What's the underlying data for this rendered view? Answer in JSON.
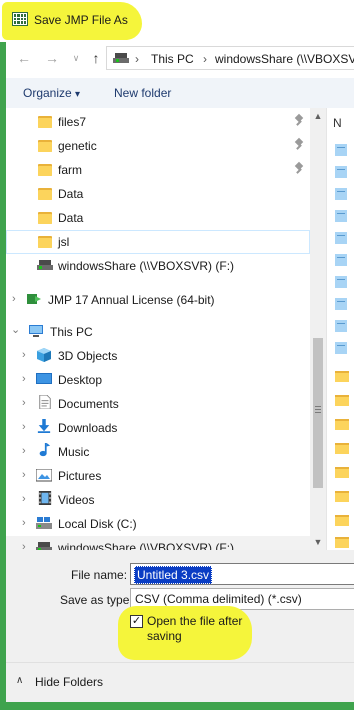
{
  "window": {
    "title": "Save JMP File As",
    "highlight_color": "#f5f53b",
    "frame_color": "#3fa34d"
  },
  "address": {
    "back_icon": "←",
    "forward_icon": "→",
    "dropdown_icon": "∨",
    "up_icon": "↑",
    "chevron": "›",
    "crumbs": [
      "This PC",
      "windowsShare (\\\\VBOXSVR"
    ]
  },
  "toolbar": {
    "organize_label": "Organize",
    "organize_arrow": "▾",
    "new_folder_label": "New folder"
  },
  "nav_pane": {
    "quick_items": [
      {
        "label": "files7",
        "pinned": true
      },
      {
        "label": "genetic",
        "pinned": true
      },
      {
        "label": "farm",
        "pinned": true
      },
      {
        "label": "Data",
        "pinned": false
      },
      {
        "label": "Data",
        "pinned": false
      },
      {
        "label": "jsl",
        "pinned": false
      }
    ],
    "share_quick": "windowsShare (\\\\VBOXSVR) (F:)",
    "jmp_license": "JMP 17 Annual License (64-bit)",
    "this_pc": "This PC",
    "pc_items": [
      {
        "label": "3D Objects",
        "icon": "3d-objects-icon"
      },
      {
        "label": "Desktop",
        "icon": "desktop-icon"
      },
      {
        "label": "Documents",
        "icon": "documents-icon"
      },
      {
        "label": "Downloads",
        "icon": "downloads-icon"
      },
      {
        "label": "Music",
        "icon": "music-icon"
      },
      {
        "label": "Pictures",
        "icon": "pictures-icon"
      },
      {
        "label": "Videos",
        "icon": "videos-icon"
      },
      {
        "label": "Local Disk (C:)",
        "icon": "local-disk-icon"
      },
      {
        "label": "windowsShare (\\\\VBOXSVR) (F:)",
        "icon": "network-drive-icon"
      }
    ],
    "expand_chevron": "›",
    "collapse_chevron": "⌄"
  },
  "file_list": {
    "column_header": "N"
  },
  "form": {
    "file_name_label": "File name:",
    "file_name_value": "Untitled 3.csv",
    "save_type_label": "Save as type:",
    "save_type_value": "CSV (Comma delimited) (*.csv)",
    "open_after_label": "Open the file after saving",
    "open_after_checked": true,
    "check_mark": "✓"
  },
  "footer": {
    "hide_folders_label": "Hide Folders",
    "hide_chevron": "∧"
  }
}
